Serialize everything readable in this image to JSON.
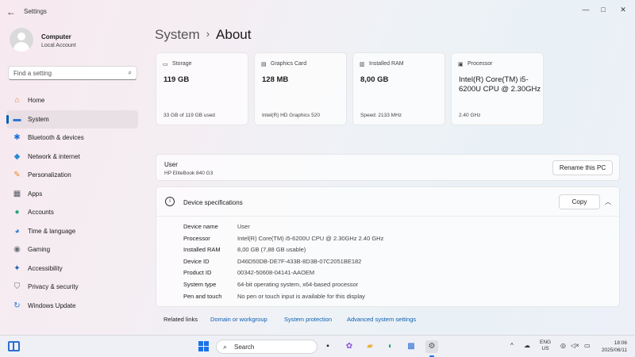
{
  "window": {
    "title": "Settings",
    "back_glyph": "←",
    "minimize_glyph": "—",
    "maximize_glyph": "□",
    "close_glyph": "✕"
  },
  "account": {
    "name": "Computer",
    "type": "Local Account"
  },
  "search": {
    "placeholder": "Find a setting",
    "icon": "search-icon"
  },
  "nav": {
    "items": [
      {
        "label": "Home",
        "icon": "home-icon",
        "glyph": "⌂",
        "color": "#d77a3a",
        "active": false
      },
      {
        "label": "System",
        "icon": "system-monitor-icon",
        "glyph": "▬",
        "color": "#2a78d6",
        "active": true
      },
      {
        "label": "Bluetooth & devices",
        "icon": "bluetooth-icon",
        "glyph": "✱",
        "color": "#1e6fd8",
        "active": false
      },
      {
        "label": "Network & internet",
        "icon": "wifi-icon",
        "glyph": "◆",
        "color": "#2a8ad6",
        "active": false
      },
      {
        "label": "Personalization",
        "icon": "brush-icon",
        "glyph": "✎",
        "color": "#e58a2a",
        "active": false
      },
      {
        "label": "Apps",
        "icon": "apps-icon",
        "glyph": "▦",
        "color": "#555a66",
        "active": false
      },
      {
        "label": "Accounts",
        "icon": "person-icon",
        "glyph": "●",
        "color": "#27a37a",
        "active": false
      },
      {
        "label": "Time & language",
        "icon": "globe-clock-icon",
        "glyph": "◕",
        "color": "#2a78d6",
        "active": false
      },
      {
        "label": "Gaming",
        "icon": "gamepad-icon",
        "glyph": "◉",
        "color": "#6b6f78",
        "active": false
      },
      {
        "label": "Accessibility",
        "icon": "accessibility-icon",
        "glyph": "✦",
        "color": "#1e5fb8",
        "active": false
      },
      {
        "label": "Privacy & security",
        "icon": "shield-icon",
        "glyph": "⛉",
        "color": "#6b6f78",
        "active": false
      },
      {
        "label": "Windows Update",
        "icon": "update-icon",
        "glyph": "↻",
        "color": "#1e78d6",
        "active": false
      }
    ]
  },
  "breadcrumb": {
    "parent": "System",
    "separator": "›",
    "current": "About"
  },
  "cards": [
    {
      "label": "Storage",
      "icon": "storage-icon",
      "glyph": "▭",
      "value": "119 GB",
      "sub": "33 GB of 119 GB used"
    },
    {
      "label": "Graphics Card",
      "icon": "graphics-card-icon",
      "glyph": "▤",
      "value": "128 MB",
      "sub": "Intel(R) HD Graphics 520"
    },
    {
      "label": "Installed RAM",
      "icon": "ram-icon",
      "glyph": "▥",
      "value": "8,00 GB",
      "sub": "Speed: 2133 MHz"
    },
    {
      "label": "Processor",
      "icon": "processor-icon",
      "glyph": "▣",
      "value": "Intel(R) Core(TM) i5-6200U CPU @ 2.30GHz",
      "sub": "2.40 GHz"
    }
  ],
  "pc": {
    "name": "User",
    "model": "HP EliteBook 840 G3",
    "rename_label": "Rename this PC"
  },
  "device_specs": {
    "title": "Device specifications",
    "copy_label": "Copy",
    "info_glyph": "i",
    "collapse_glyph": "︿",
    "rows": [
      {
        "key": "Device name",
        "value": "User"
      },
      {
        "key": "Processor",
        "value": "Intel(R) Core(TM) i5-6200U CPU @ 2.30GHz   2.40 GHz"
      },
      {
        "key": "Installed RAM",
        "value": "8,00 GB (7,88 GB usable)"
      },
      {
        "key": "Device ID",
        "value": "D46D50DB-DE7F-433B-8D3B-07C2051BE182"
      },
      {
        "key": "Product ID",
        "value": "00342-50608-04141-AAOEM"
      },
      {
        "key": "System type",
        "value": "64-bit operating system, x64-based processor"
      },
      {
        "key": "Pen and touch",
        "value": "No pen or touch input is available for this display"
      }
    ]
  },
  "related": {
    "label": "Related links",
    "links": [
      "Domain or workgroup",
      "System protection",
      "Advanced system settings"
    ]
  },
  "taskbar": {
    "search_text": "Search",
    "apps": [
      {
        "name": "task-view-icon",
        "glyph": "▪",
        "color": "#222"
      },
      {
        "name": "copilot-icon",
        "glyph": "✿",
        "color": "#8a4fe0"
      },
      {
        "name": "file-explorer-icon",
        "glyph": "▰",
        "color": "#e8b23a"
      },
      {
        "name": "edge-icon",
        "glyph": "◐",
        "color": "#1c9a6c"
      },
      {
        "name": "store-icon",
        "glyph": "▩",
        "color": "#2a6fd1"
      },
      {
        "name": "settings-app-icon",
        "glyph": "⚙",
        "color": "#4b5563"
      }
    ],
    "tray": {
      "chevron_glyph": "^",
      "cloud_glyph": "☁",
      "lang_top": "ENG",
      "lang_bottom": "US",
      "network_glyph": "◎",
      "volume_glyph": "◁×",
      "battery_glyph": "▭"
    },
    "time": "18:06",
    "date": "2025/06/11"
  }
}
